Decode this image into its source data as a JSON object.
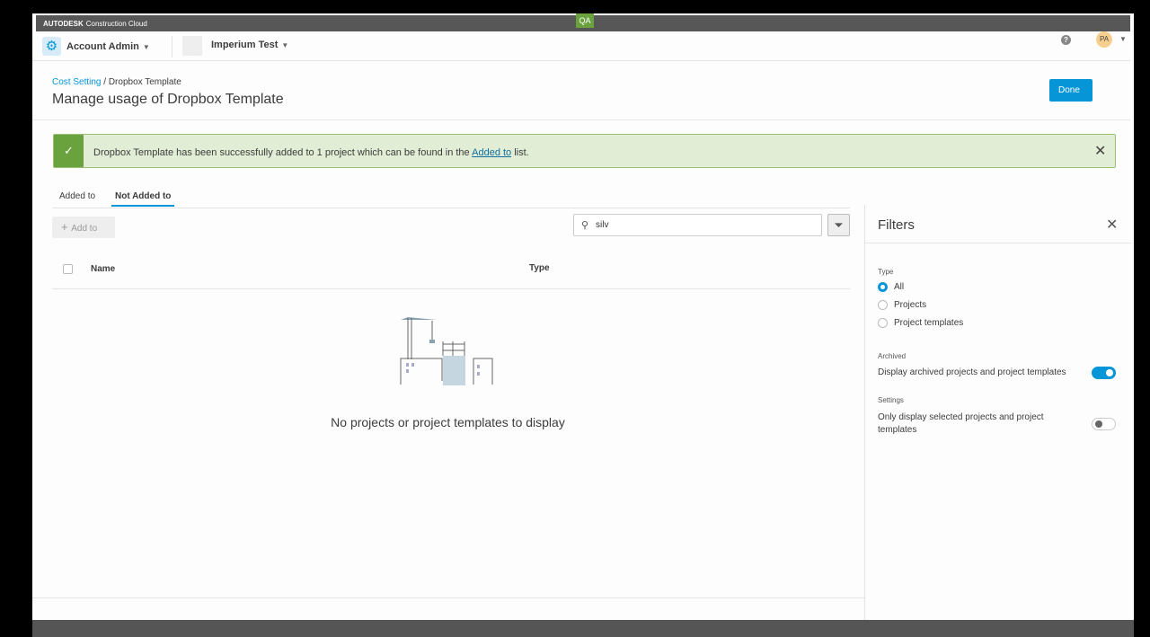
{
  "topbar": {
    "brand": "AUTODESK",
    "product": "Construction Cloud",
    "env_badge": "QA"
  },
  "nav": {
    "account": "Account Admin",
    "project": "Imperium Test",
    "avatar": "PA",
    "help": "?"
  },
  "breadcrumb": {
    "parent": "Cost Setting",
    "separator": "/",
    "current": "Dropbox Template"
  },
  "page_title": "Manage usage of Dropbox Template",
  "done_label": "Done",
  "banner": {
    "text_before": "Dropbox Template has been successfully added to 1 project which can be found in the ",
    "link": "Added to",
    "text_after": " list."
  },
  "tabs": [
    {
      "label": "Added to"
    },
    {
      "label": "Not Added to",
      "active": true
    }
  ],
  "toolbar": {
    "add_label": "Add to",
    "search_value": "silv"
  },
  "table": {
    "columns": [
      "Name",
      "Type"
    ],
    "empty_text": "No projects or project templates to display"
  },
  "filters": {
    "title": "Filters",
    "type_label": "Type",
    "type_options": [
      {
        "label": "All",
        "selected": true
      },
      {
        "label": "Projects",
        "selected": false
      },
      {
        "label": "Project templates",
        "selected": false
      }
    ],
    "archived_label": "Archived",
    "archived_text": "Display archived projects and project templates",
    "archived_on": true,
    "settings_label": "Settings",
    "settings_text": "Only display selected projects and project templates",
    "settings_on": false
  },
  "colors": {
    "accent": "#0696d7",
    "success": "#6aa33e"
  }
}
